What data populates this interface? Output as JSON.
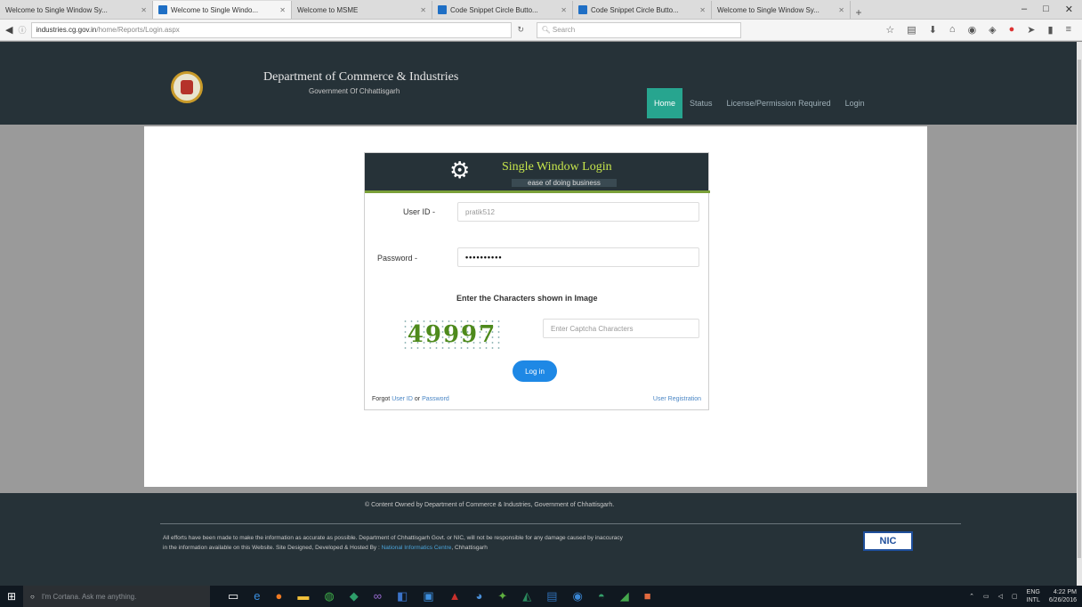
{
  "browser": {
    "tabs": [
      {
        "label": "Welcome to Single Window Sy...",
        "active": false
      },
      {
        "label": "Welcome to Single Windo...",
        "active": true
      },
      {
        "label": "Welcome to MSME",
        "active": false
      },
      {
        "label": "Code Snippet Circle Butto...",
        "active": false
      },
      {
        "label": "Code Snippet Circle Butto...",
        "active": false
      },
      {
        "label": "Welcome to Single Window Sy...",
        "active": false
      }
    ],
    "newtab": "+",
    "minimize": "–",
    "maximize": "□",
    "close": "✕",
    "url_domain": "industries.cg.gov.in",
    "url_path": "/home/Reports/Login.aspx",
    "search_placeholder": "Search"
  },
  "header": {
    "dept_title": "Department of Commerce & Industries",
    "govt_subtitle": "Government Of Chhattisgarh",
    "menu": [
      "Home",
      "Status",
      "License/Permission Required",
      "Login"
    ]
  },
  "login": {
    "title": "Single Window Login",
    "subtitle": "ease of doing business",
    "userid_label": "User ID -",
    "userid_value": "pratik512",
    "password_label": "Password -",
    "password_value": "••••••••••",
    "captcha_title": "Enter the Characters shown in Image",
    "captcha_text": "49997",
    "captcha_placeholder": "Enter Captcha Characters",
    "login_button": "Log in",
    "forgot_text": "Forgot",
    "forgot_userid": "User ID",
    "forgot_or": "or",
    "forgot_password": "Password",
    "register": "User Registration"
  },
  "footer": {
    "owned": "© Content Owned by Department of Commerce & Industries, Government of Chhattisgarh.",
    "disclaimer_1": "All efforts have been made to make the information as accurate as possible. Department of Chhattisgarh Govt. or NIC, will not be responsible for any damage caused by inaccuracy",
    "disclaimer_2": "in the information available on this Website. Site Designed, Developed & Hosted By :",
    "nic_link": "National Informatics Centre",
    "disclaimer_3": ", Chhattisgarh",
    "nic_logo": "NIC"
  },
  "taskbar": {
    "cortana": "I'm Cortana. Ask me anything.",
    "lang1": "ENG",
    "lang2": "INTL",
    "time": "4:22 PM",
    "date": "6/26/2016"
  }
}
